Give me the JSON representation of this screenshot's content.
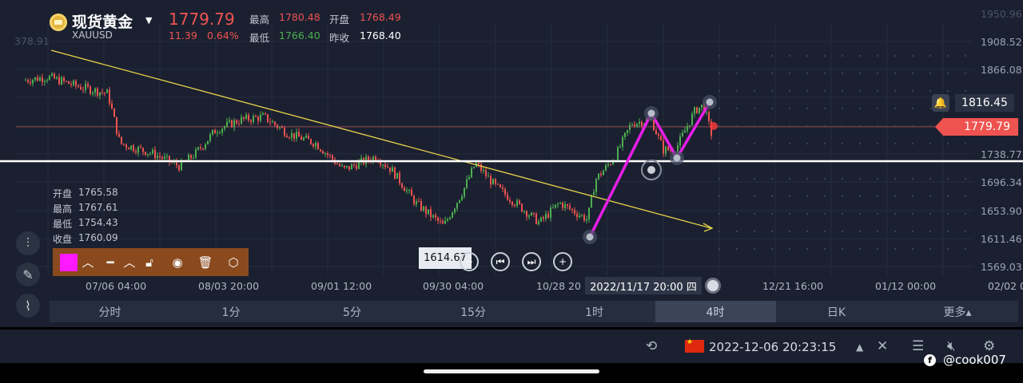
{
  "header": {
    "symbol_name": "现货黄金",
    "symbol_code": "XAUUSD",
    "last_price": "1779.79",
    "change": "11.39",
    "change_pct": "0.64%",
    "high_label": "最高",
    "high_value": "1780.48",
    "open_label": "开盘",
    "open_value": "1768.49",
    "low_label": "最低",
    "low_value": "1766.40",
    "prev_close_label": "昨收",
    "prev_close_value": "1768.40"
  },
  "y_axis": {
    "ticks": [
      "1908.52",
      "1866.08",
      "1738.77",
      "1696.34",
      "1653.90",
      "1611.46",
      "1569.03"
    ],
    "faded_ticks": [
      "1950.96",
      "378.91"
    ],
    "alert_price": "1816.45",
    "current_price_tag": "1779.79"
  },
  "x_axis": {
    "ticks": [
      "07/06 04:00",
      "08/03 20:00",
      "09/01 12:00",
      "09/30 04:00",
      "10/28 20",
      "12/21 16:00",
      "01/12 00:00",
      "02/02 0"
    ]
  },
  "ohlc_box": {
    "open_label": "开盘",
    "open_value": "1765.58",
    "high_label": "最高",
    "high_value": "1767.61",
    "low_label": "最低",
    "low_value": "1754.43",
    "close_label": "收盘",
    "close_value": "1760.09"
  },
  "tooltips": {
    "low_marker": "1614.67",
    "crosshair_date": "2022/11/17 20:00 四"
  },
  "drawing_toolbar": {
    "color": "#ff19ff",
    "icons": [
      "color-swatch",
      "chevron-up-icon",
      "line-style-icon",
      "chevron-up-icon",
      "unlock-icon",
      "eye-icon",
      "trash-icon",
      "settings-icon"
    ]
  },
  "nav_controls": [
    "zoom-out-icon",
    "jump-start-icon",
    "jump-end-icon",
    "zoom-in-icon"
  ],
  "periods": [
    {
      "label": "分时",
      "active": false
    },
    {
      "label": "1分",
      "active": false
    },
    {
      "label": "5分",
      "active": false
    },
    {
      "label": "15分",
      "active": false
    },
    {
      "label": "1时",
      "active": false
    },
    {
      "label": "4时",
      "active": true
    },
    {
      "label": "日K",
      "active": false
    },
    {
      "label": "更多▴",
      "active": false
    }
  ],
  "status_bar": {
    "datetime": "2022-12-06 20:23:15",
    "flag": "china-flag"
  },
  "watermark": "@cook007",
  "colors": {
    "up": "#4caf50",
    "down": "#ef5350",
    "trend_line": "#e8d34a",
    "pattern": "#e81ee8",
    "support_line": "#ffffff",
    "toolbar_bg": "#8a4a1e"
  },
  "chart_data": {
    "type": "candlestick",
    "interval": "4时",
    "y_range": [
      1569.03,
      1950.96
    ],
    "grid": true,
    "approx_close_path": [
      {
        "x": "07/06 04:00",
        "y": 1810
      },
      {
        "x": "08/03 20:00",
        "y": 1770
      },
      {
        "x": "09/01 12:00",
        "y": 1715
      },
      {
        "x": "09/30 04:00",
        "y": 1665
      },
      {
        "x": "10/28 20",
        "y": 1645
      },
      {
        "x": "2022/11/17 20:00",
        "y": 1790
      },
      {
        "x": "latest",
        "y": 1779.79
      }
    ],
    "annotations": [
      {
        "type": "trendline",
        "color": "yellow",
        "direction": "descending"
      },
      {
        "type": "horizontal",
        "color": "white",
        "price": 1735
      },
      {
        "type": "polyline",
        "color": "magenta",
        "points": [
          1614.67,
          1798,
          1735,
          1816.45
        ]
      }
    ]
  }
}
